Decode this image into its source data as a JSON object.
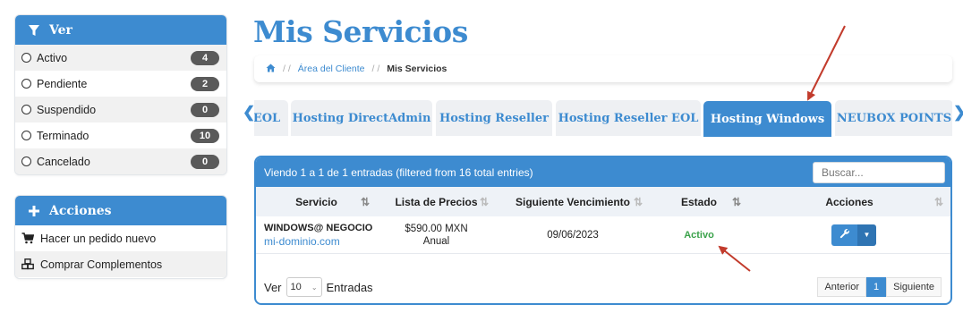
{
  "sidebar": {
    "filter": {
      "title": "Ver",
      "items": [
        {
          "label": "Activo",
          "count": "4"
        },
        {
          "label": "Pendiente",
          "count": "2"
        },
        {
          "label": "Suspendido",
          "count": "0"
        },
        {
          "label": "Terminado",
          "count": "10"
        },
        {
          "label": "Cancelado",
          "count": "0"
        }
      ]
    },
    "actions": {
      "title": "Acciones",
      "items": [
        {
          "label": "Hacer un pedido nuevo",
          "icon": "cart-icon"
        },
        {
          "label": "Comprar Complementos",
          "icon": "cubes-icon"
        }
      ]
    }
  },
  "main": {
    "title": "Mis Servicios",
    "breadcrumb": {
      "home_icon": "home-icon",
      "link": "Área del Cliente",
      "current": "Mis Servicios"
    },
    "tabs": [
      {
        "label": "EOL"
      },
      {
        "label": "Hosting DirectAdmin"
      },
      {
        "label": "Hosting Reseller"
      },
      {
        "label": "Hosting Reseller EOL"
      },
      {
        "label": "Hosting Windows",
        "active": true
      },
      {
        "label": "NEUBOX POINTS"
      }
    ],
    "table": {
      "info": "Viendo 1 a 1 de 1 entradas (filtered from 16 total entries)",
      "search_placeholder": "Buscar...",
      "columns": [
        "Servicio",
        "Lista de Precios",
        "Siguiente Vencimiento",
        "Estado",
        "Acciones"
      ],
      "rows": [
        {
          "service": "WINDOWS@ NEGOCIO",
          "domain": "mi-dominio.com",
          "price": "$590.00 MXN",
          "cycle": "Anual",
          "due": "09/06/2023",
          "status": "Activo"
        }
      ],
      "length_label_before": "Ver",
      "length_value": "10",
      "length_label_after": "Entradas",
      "pager": {
        "prev": "Anterior",
        "page": "1",
        "next": "Siguiente"
      }
    }
  },
  "colors": {
    "accent": "#3d8bd0",
    "active_status": "#3aa24a",
    "annotation_arrow": "#c23b2c"
  }
}
